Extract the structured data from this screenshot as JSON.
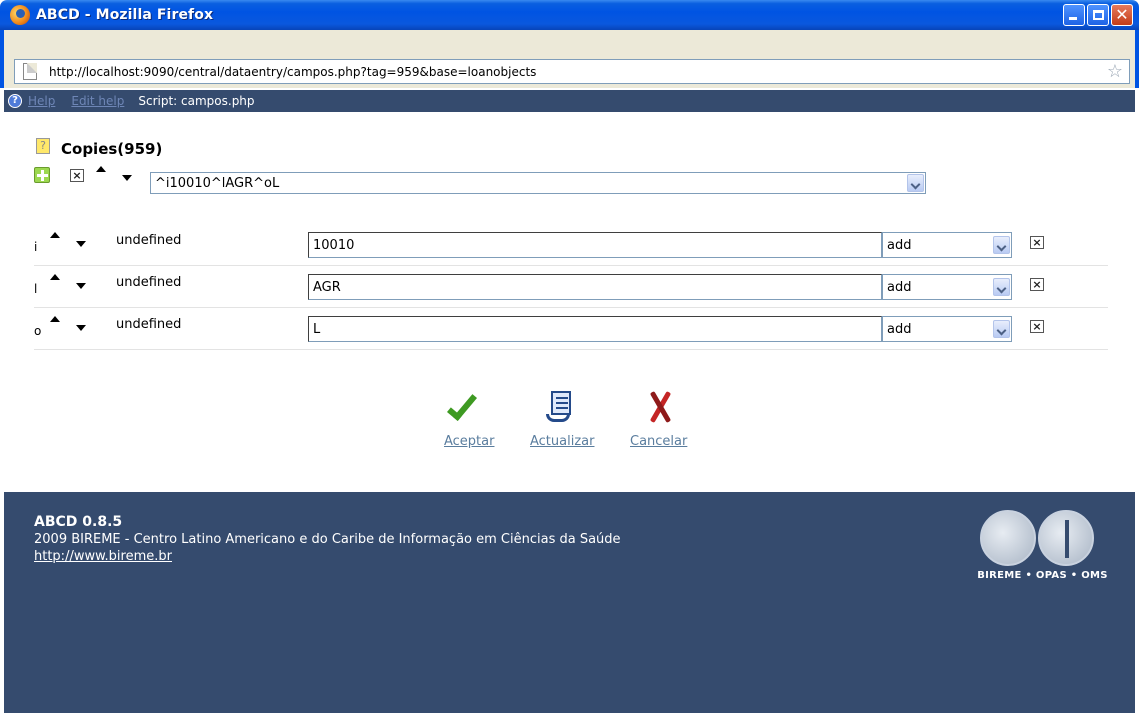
{
  "window": {
    "title": "ABCD - Mozilla Firefox"
  },
  "browser": {
    "url": "http://localhost:9090/central/dataentry/campos.php?tag=959&base=loanobjects"
  },
  "helpbar": {
    "help_label": "Help",
    "edit_help_label": "Edit help",
    "script_text": "Script: campos.php"
  },
  "field": {
    "title": "Copies(959)",
    "occurrence_value": "^i10010^lAGR^oL"
  },
  "subfields": [
    {
      "code": "i",
      "label": "undefined",
      "value": "10010",
      "action": "add"
    },
    {
      "code": "l",
      "label": "undefined",
      "value": "AGR",
      "action": "add"
    },
    {
      "code": "o",
      "label": "undefined",
      "value": "L",
      "action": "add"
    }
  ],
  "actions": {
    "accept": "Aceptar",
    "update": "Actualizar",
    "cancel": "Cancelar"
  },
  "footer": {
    "version": "ABCD 0.8.5",
    "credit": "2009 BIREME - Centro Latino Americano e do Caribe de Informação em Ciências da Saúde",
    "link": "http://www.bireme.br",
    "logo_text": "BIREME • OPAS • OMS"
  },
  "colors": {
    "titlebar": "#0054e3",
    "helpbar": "#354b6e",
    "footer": "#354b6e",
    "link": "#5a7d9e"
  }
}
